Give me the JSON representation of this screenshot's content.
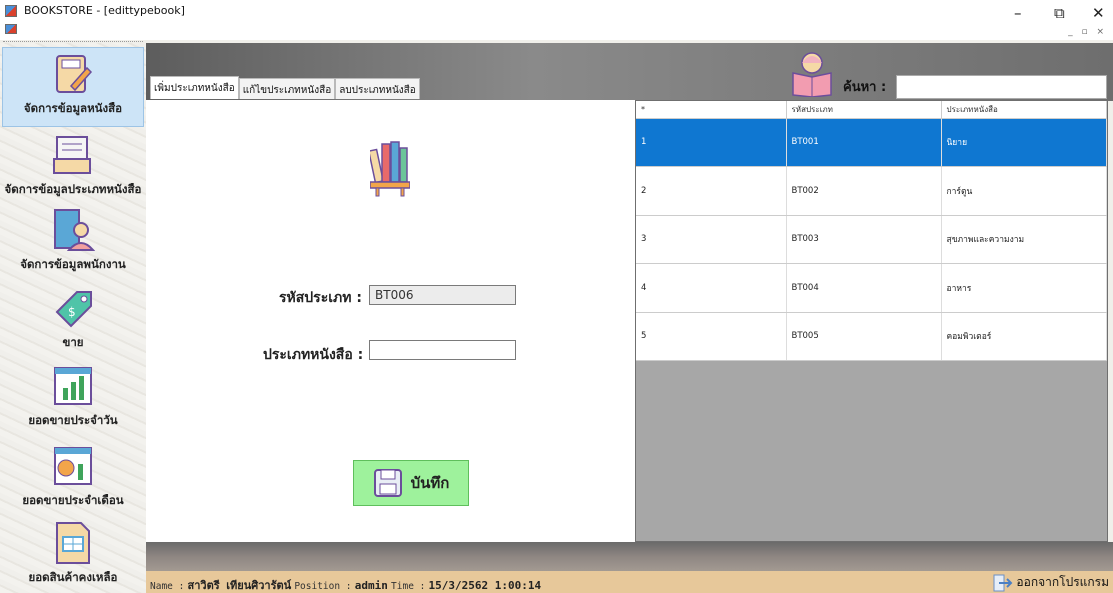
{
  "window": {
    "title": "BOOKSTORE - [edittypebook]",
    "controls": [
      "–",
      "⧉",
      "✕"
    ]
  },
  "sidebar": {
    "items": [
      {
        "label": "จัดการข้อมูลหนังสือ",
        "icon": "book-edit-icon",
        "active": true
      },
      {
        "label": "จัดการข้อมูลประเภทหนังสือ",
        "icon": "inbox-tray-icon"
      },
      {
        "label": "จัดการข้อมูลพนักงาน",
        "icon": "employee-building-icon"
      },
      {
        "label": "ขาย",
        "icon": "price-tag-icon"
      },
      {
        "label": "ยอดขายประจำวัน",
        "icon": "daily-chart-icon"
      },
      {
        "label": "ยอดขายประจำเดือน",
        "icon": "monthly-money-chart-icon"
      },
      {
        "label": "ยอดสินค้าคงเหลือ",
        "icon": "stock-table-icon"
      }
    ]
  },
  "tabs": [
    "เพิ่มประเภทหนังสือ",
    "แก้ไขประเภทหนังสือ",
    "ลบประเภทหนังสือ"
  ],
  "form": {
    "type_id_label": "รหัสประเภท :",
    "type_id_value": "BT006",
    "type_name_label": "ประเภทหนังสือ :",
    "type_name_value": "",
    "save_label": "บันทึก"
  },
  "search": {
    "label": "ค้นหา :",
    "value": ""
  },
  "grid": {
    "columns": [
      "*",
      "รหัสประเภท",
      "ประเภทหนังสือ"
    ],
    "rows": [
      {
        "no": "1",
        "id": "BT001",
        "name": "นิยาย",
        "selected": true
      },
      {
        "no": "2",
        "id": "BT002",
        "name": "การ์ตูน"
      },
      {
        "no": "3",
        "id": "BT003",
        "name": "สุขภาพและความงาม"
      },
      {
        "no": "4",
        "id": "BT004",
        "name": "อาหาร"
      },
      {
        "no": "5",
        "id": "BT005",
        "name": "คอมพิวเตอร์"
      }
    ]
  },
  "status": {
    "name_key": "Name :",
    "name": "สาวิตรี เทียนศิวารัตน์",
    "position_key": "Position :",
    "position": "admin",
    "time_key": "Time :",
    "time": "15/3/2562 1:00:14"
  },
  "exit_label": "ออกจากโปรแกรม"
}
